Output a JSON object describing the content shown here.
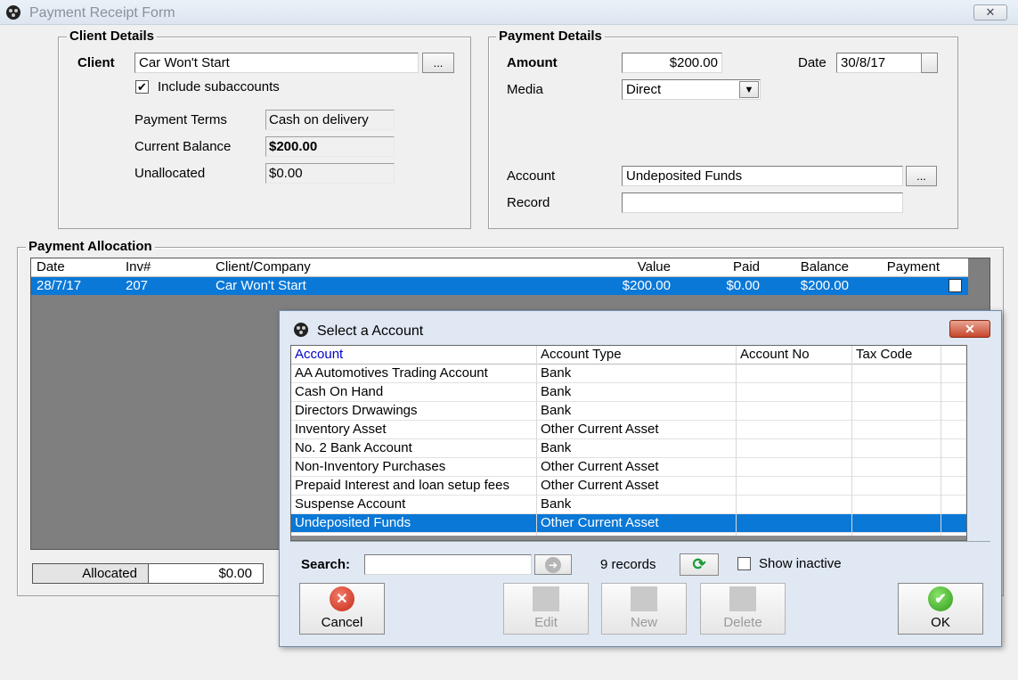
{
  "window": {
    "title": "Payment Receipt Form",
    "close_glyph": "✕"
  },
  "client_details": {
    "group_label": "Client Details",
    "client_label": "Client",
    "client_value": "Car Won't Start",
    "browse_label": "...",
    "include_sub_label": "Include subaccounts",
    "include_sub_checked": true,
    "terms_label": "Payment Terms",
    "terms_value": "Cash on delivery",
    "balance_label": "Current Balance",
    "balance_value": "$200.00",
    "unalloc_label": "Unallocated",
    "unalloc_value": "$0.00"
  },
  "payment_details": {
    "group_label": "Payment Details",
    "amount_label": "Amount",
    "amount_value": "$200.00",
    "date_label": "Date",
    "date_value": "30/8/17",
    "media_label": "Media",
    "media_value": "Direct",
    "account_label": "Account",
    "account_value": "Undeposited Funds",
    "account_browse": "...",
    "record_label": "Record",
    "record_value": ""
  },
  "allocation": {
    "group_label": "Payment Allocation",
    "columns": [
      "Date",
      "Inv#",
      "Client/Company",
      "Value",
      "Paid",
      "Balance",
      "Payment"
    ],
    "rows": [
      {
        "date": "28/7/17",
        "inv": "207",
        "client": "Car Won't Start",
        "value": "$200.00",
        "paid": "$0.00",
        "balance": "$200.00"
      }
    ],
    "allocated_label": "Allocated",
    "allocated_value": "$0.00"
  },
  "dialog": {
    "title": "Select a Account",
    "close_glyph": "✕",
    "columns": [
      "Account",
      "Account Type",
      "Account No",
      "Tax Code"
    ],
    "rows": [
      {
        "account": "AA Automotives Trading Account",
        "type": "Bank",
        "no": "",
        "tax": ""
      },
      {
        "account": "Cash On Hand",
        "type": "Bank",
        "no": "",
        "tax": ""
      },
      {
        "account": "Directors Drwawings",
        "type": "Bank",
        "no": "",
        "tax": ""
      },
      {
        "account": "Inventory Asset",
        "type": "Other Current Asset",
        "no": "",
        "tax": ""
      },
      {
        "account": "No. 2 Bank Account",
        "type": "Bank",
        "no": "",
        "tax": ""
      },
      {
        "account": "Non-Inventory Purchases",
        "type": "Other Current Asset",
        "no": "",
        "tax": ""
      },
      {
        "account": "Prepaid Interest and loan setup fees",
        "type": "Other Current Asset",
        "no": "",
        "tax": ""
      },
      {
        "account": "Suspense Account",
        "type": "Bank",
        "no": "",
        "tax": ""
      },
      {
        "account": "Undeposited Funds",
        "type": "Other Current Asset",
        "no": "",
        "tax": ""
      }
    ],
    "selected_index": 8,
    "search_label": "Search:",
    "search_value": "",
    "records_text": "9 records",
    "show_inactive_label": "Show inactive",
    "show_inactive_checked": false,
    "buttons": {
      "cancel": "Cancel",
      "edit": "Edit",
      "new": "New",
      "delete": "Delete",
      "ok": "OK"
    }
  },
  "colors": {
    "selection": "#0a78d7",
    "header_link": "#0000cc"
  }
}
